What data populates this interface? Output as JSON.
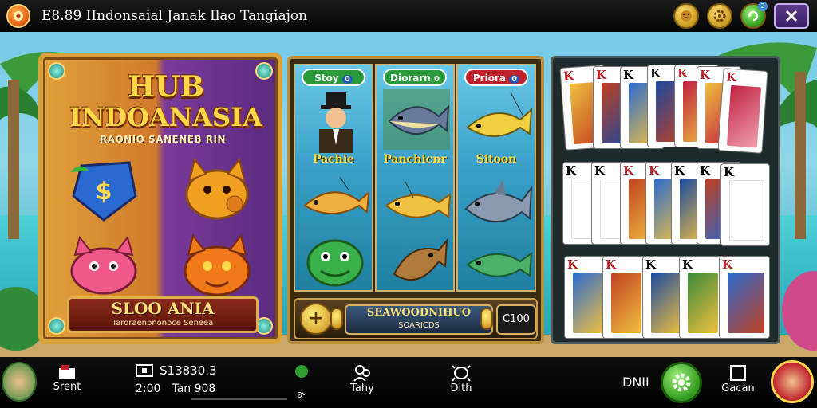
{
  "topbar": {
    "text": "E8.89   IIndonsaial   Janak   Ilao Tangiajon"
  },
  "left_panel": {
    "title_line1": "HUB",
    "title_line2": "INDOANASIA",
    "subtitle": "RAONIO SANENEB RIN",
    "banner_title": "SLOO ANIA",
    "banner_sub": "Taroraenpnonoce Seneea"
  },
  "mid_panel": {
    "col1_head": "Stoy",
    "col1_badge": "0",
    "col2_head": "Diorarn",
    "col2_badge": "0",
    "col3_head": "Priora",
    "col3_badge": "0",
    "col1_label": "Pachie",
    "col2_label": "Panchicnr",
    "col3_label": "Sitoon",
    "footer_title": "SEAWOODNIHUO",
    "footer_sub": "SOARICDS",
    "score": "C100"
  },
  "cards": {
    "row1": [
      "K",
      "K",
      "K",
      "K",
      "K",
      "K",
      "K",
      "K"
    ],
    "row2": [
      "K",
      "K",
      "K",
      "K",
      "K",
      "K",
      "K",
      "K"
    ],
    "row3": [
      "K",
      "K",
      "K",
      "K",
      "K",
      "K"
    ]
  },
  "bottombar": {
    "item1_label": "Srent",
    "item2_value": "S13830.3",
    "item2_time": "2:00",
    "item2_sub": "Tan 908",
    "item3_label": "Tahy",
    "item4_label": "Dith",
    "item5_label": "DNII",
    "item6_label": "Gacan"
  },
  "colors": {
    "gold": "#ffd84a",
    "accent_green": "#2f9a1c",
    "accent_red": "#c0202a"
  }
}
